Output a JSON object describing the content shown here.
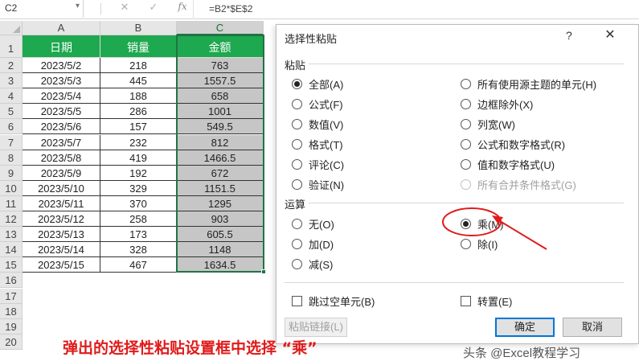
{
  "formula_bar": {
    "name_box": "C2",
    "cancel_icon": "✕",
    "enter_icon": "✓",
    "fx_label": "fx",
    "formula": "=B2*$E$2"
  },
  "sheet": {
    "columns": [
      "A",
      "B",
      "C"
    ],
    "rows": [
      "1",
      "2",
      "3",
      "4",
      "5",
      "6",
      "7",
      "8",
      "9",
      "10",
      "11",
      "12",
      "13",
      "14",
      "15",
      "16",
      "17",
      "18",
      "19",
      "20"
    ],
    "headers": [
      "日期",
      "销量",
      "金额"
    ],
    "data": [
      [
        "2023/5/2",
        "218",
        "763"
      ],
      [
        "2023/5/3",
        "445",
        "1557.5"
      ],
      [
        "2023/5/4",
        "188",
        "658"
      ],
      [
        "2023/5/5",
        "286",
        "1001"
      ],
      [
        "2023/5/6",
        "157",
        "549.5"
      ],
      [
        "2023/5/7",
        "232",
        "812"
      ],
      [
        "2023/5/8",
        "419",
        "1466.5"
      ],
      [
        "2023/5/9",
        "192",
        "672"
      ],
      [
        "2023/5/10",
        "329",
        "1151.5"
      ],
      [
        "2023/5/11",
        "370",
        "1295"
      ],
      [
        "2023/5/12",
        "258",
        "903"
      ],
      [
        "2023/5/13",
        "173",
        "605.5"
      ],
      [
        "2023/5/14",
        "328",
        "1148"
      ],
      [
        "2023/5/15",
        "467",
        "1634.5"
      ]
    ]
  },
  "dialog": {
    "title": "选择性粘贴",
    "help": "?",
    "close": "✕",
    "paste_group": "粘贴",
    "paste_left": [
      {
        "label": "全部(A)",
        "checked": true
      },
      {
        "label": "公式(F)",
        "checked": false
      },
      {
        "label": "数值(V)",
        "checked": false
      },
      {
        "label": "格式(T)",
        "checked": false
      },
      {
        "label": "评论(C)",
        "checked": false
      },
      {
        "label": "验证(N)",
        "checked": false
      }
    ],
    "paste_right": [
      {
        "label": "所有使用源主题的单元(H)",
        "checked": false,
        "disabled": false
      },
      {
        "label": "边框除外(X)",
        "checked": false,
        "disabled": false
      },
      {
        "label": "列宽(W)",
        "checked": false,
        "disabled": false
      },
      {
        "label": "公式和数字格式(R)",
        "checked": false,
        "disabled": false
      },
      {
        "label": "值和数字格式(U)",
        "checked": false,
        "disabled": false
      },
      {
        "label": "所有合并条件格式(G)",
        "checked": false,
        "disabled": true
      }
    ],
    "operation_group": "运算",
    "op_left": [
      {
        "label": "无(O)",
        "checked": false
      },
      {
        "label": "加(D)",
        "checked": false
      },
      {
        "label": "减(S)",
        "checked": false
      }
    ],
    "op_right": [
      {
        "label": "乘(M)",
        "checked": true
      },
      {
        "label": "除(I)",
        "checked": false
      }
    ],
    "skip_blanks": "跳过空单元(B)",
    "transpose": "转置(E)",
    "paste_link": "粘贴链接(L)",
    "ok": "确定",
    "cancel": "取消"
  },
  "annotation": {
    "caption": "弹出的选择性粘贴设置框中选择 “乘”",
    "color": "#e01b1b"
  },
  "watermark": "头条 @Excel教程学习"
}
